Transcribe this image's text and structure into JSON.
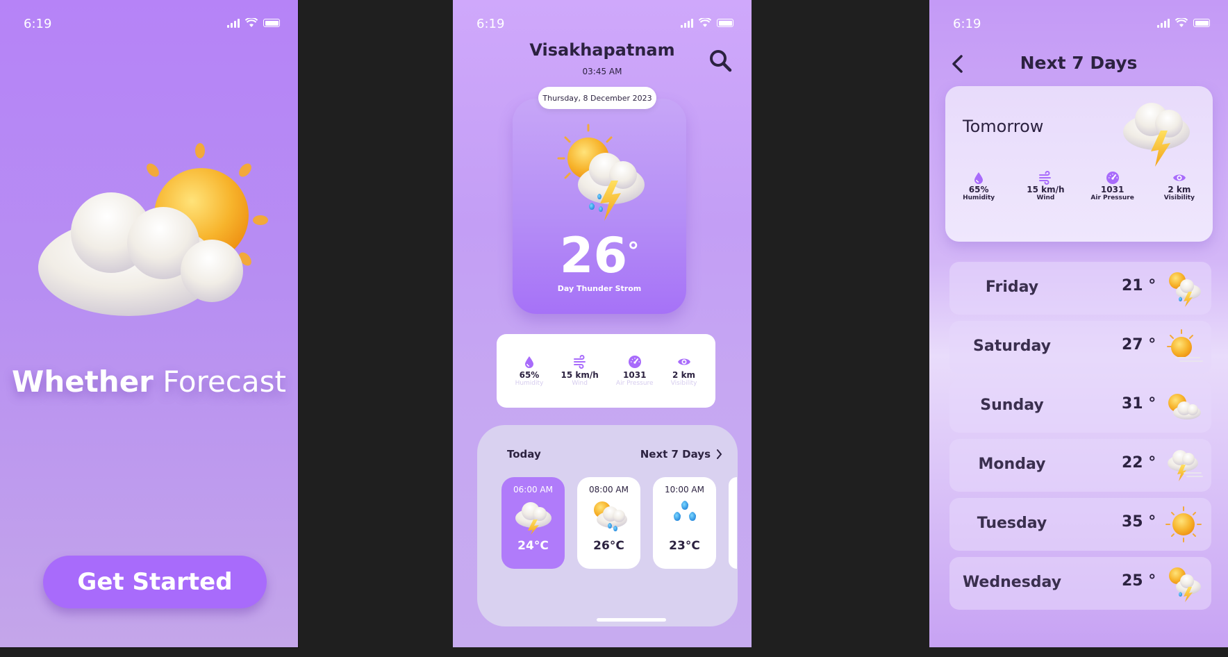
{
  "status": {
    "time": "6:19"
  },
  "onboarding": {
    "title_bold": "Whether",
    "title_light": "Forecast",
    "cta_label": "Get Started",
    "icon": "sun-behind-cloud-icon"
  },
  "home": {
    "city": "Visakhapatnam",
    "time": "03:45 AM",
    "date": "Thursday, 8 December 2023",
    "temperature": "26",
    "degree": "°",
    "condition": "Day Thunder Strom",
    "icon": "sun-thunder-rain-icon",
    "stats": [
      {
        "icon": "humidity-drop-icon",
        "value": "65%",
        "label": "Humidity"
      },
      {
        "icon": "wind-icon",
        "value": "15 km/h",
        "label": "Wind"
      },
      {
        "icon": "pressure-gauge-icon",
        "value": "1031",
        "label": "Air Pressure"
      },
      {
        "icon": "visibility-eye-icon",
        "value": "2 km",
        "label": "Visibility"
      }
    ],
    "today_label": "Today",
    "next_days_label": "Next 7 Days",
    "hourly": [
      {
        "time": "06:00 AM",
        "temp": "24°C",
        "icon": "thunder-cloud-icon",
        "active": true
      },
      {
        "time": "08:00 AM",
        "temp": "26°C",
        "icon": "sun-cloud-rain-icon",
        "active": false
      },
      {
        "time": "10:00 AM",
        "temp": "23°C",
        "icon": "raindrops-icon",
        "active": false
      }
    ]
  },
  "forecast": {
    "title": "Next 7 Days",
    "tomorrow_label": "Tomorrow",
    "tomorrow_icon": "thunder-cloud-icon",
    "stats": [
      {
        "icon": "humidity-drop-icon",
        "value": "65%",
        "label": "Humidity"
      },
      {
        "icon": "wind-icon",
        "value": "15 km/h",
        "label": "Wind"
      },
      {
        "icon": "pressure-gauge-icon",
        "value": "1031",
        "label": "Air Pressure"
      },
      {
        "icon": "visibility-eye-icon",
        "value": "2 km",
        "label": "Visibility"
      }
    ],
    "days": [
      {
        "day": "Friday",
        "temp": "21 °",
        "icon": "sun-thunder-rain-icon"
      },
      {
        "day": "Saturday",
        "temp": "27 °",
        "icon": "sun-wind-icon"
      },
      {
        "day": "Sunday",
        "temp": "31 °",
        "icon": "sun-cloud-icon"
      },
      {
        "day": "Monday",
        "temp": "22 °",
        "icon": "thunder-cloud-wind-icon"
      },
      {
        "day": "Tuesday",
        "temp": "35 °",
        "icon": "sun-icon"
      },
      {
        "day": "Wednesday",
        "temp": "25 °",
        "icon": "sun-thunder-rain-icon"
      }
    ]
  },
  "colors": {
    "primary": "#a86bfb",
    "text_dark": "#2c2240",
    "sun": "#f7b42c",
    "bolt": "#f5c32c"
  }
}
